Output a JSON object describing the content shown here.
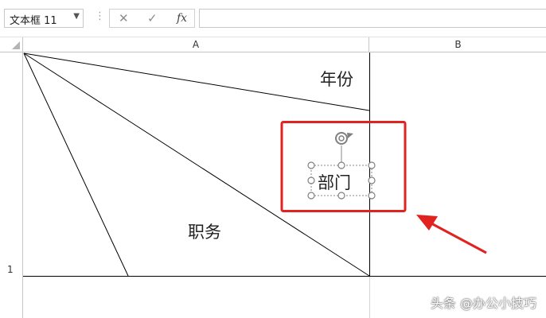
{
  "toolbar": {
    "name_box": "文本框 11",
    "separator": "⋮",
    "cancel_label": "✕",
    "enter_label": "✓",
    "function_label": "fx",
    "formula_value": ""
  },
  "sheet": {
    "columns": [
      "A",
      "B"
    ],
    "rows": [
      "1"
    ]
  },
  "cell_a1": {
    "label_top": "年份",
    "label_bottom": "职务",
    "textbox_text": "部门"
  },
  "colors": {
    "highlight": "#e1231f",
    "arrow": "#e1231f",
    "handle": "#7f7f7f"
  },
  "watermark": "头条 @办公小技巧"
}
